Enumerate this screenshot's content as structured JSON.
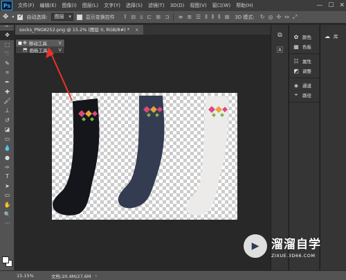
{
  "menubar": {
    "logo": "Ps",
    "items": [
      "文件(F)",
      "编辑(E)",
      "图像(I)",
      "图层(L)",
      "文字(Y)",
      "选择(S)",
      "滤镜(T)",
      "3D(D)",
      "视图(V)",
      "窗口(W)",
      "帮助(H)"
    ],
    "minimize": "—",
    "maximize": "☐",
    "close": "✕"
  },
  "options": {
    "tool_icon": "move-tool-icon",
    "auto_select_label": "自动选择:",
    "auto_select_value": "图层",
    "show_transform_label": "显示变换控件",
    "mode_3d": "3D 模式:"
  },
  "document": {
    "tab_title": "socks_PNG8252.png @ 15.2% (图层 0, RGB/8#) *",
    "close": "×"
  },
  "flyout": {
    "items": [
      {
        "label": "移动工具",
        "key": "V",
        "selected": true
      },
      {
        "label": "画板工具",
        "key": "V",
        "selected": false
      }
    ]
  },
  "panels": {
    "group1": [
      "颜色",
      "色板"
    ],
    "group2": [
      "属性",
      "调整"
    ],
    "group3": [
      "通道",
      "路径"
    ],
    "library": "库"
  },
  "status": {
    "zoom": "15.15%",
    "doc_info": "文档:20.4M/27.6M",
    "arrow": "›"
  },
  "watermark": {
    "title": "溜溜自学",
    "url": "ZIXUE.3D66.COM"
  },
  "colors": {
    "accent_arrow": "#e8332a",
    "sock_black": "#14161c",
    "sock_navy": "#343c52",
    "sock_white": "#ecebea",
    "pattern_pink": "#d94a7a",
    "pattern_orange": "#e8a23a",
    "pattern_green": "#7ab648"
  }
}
